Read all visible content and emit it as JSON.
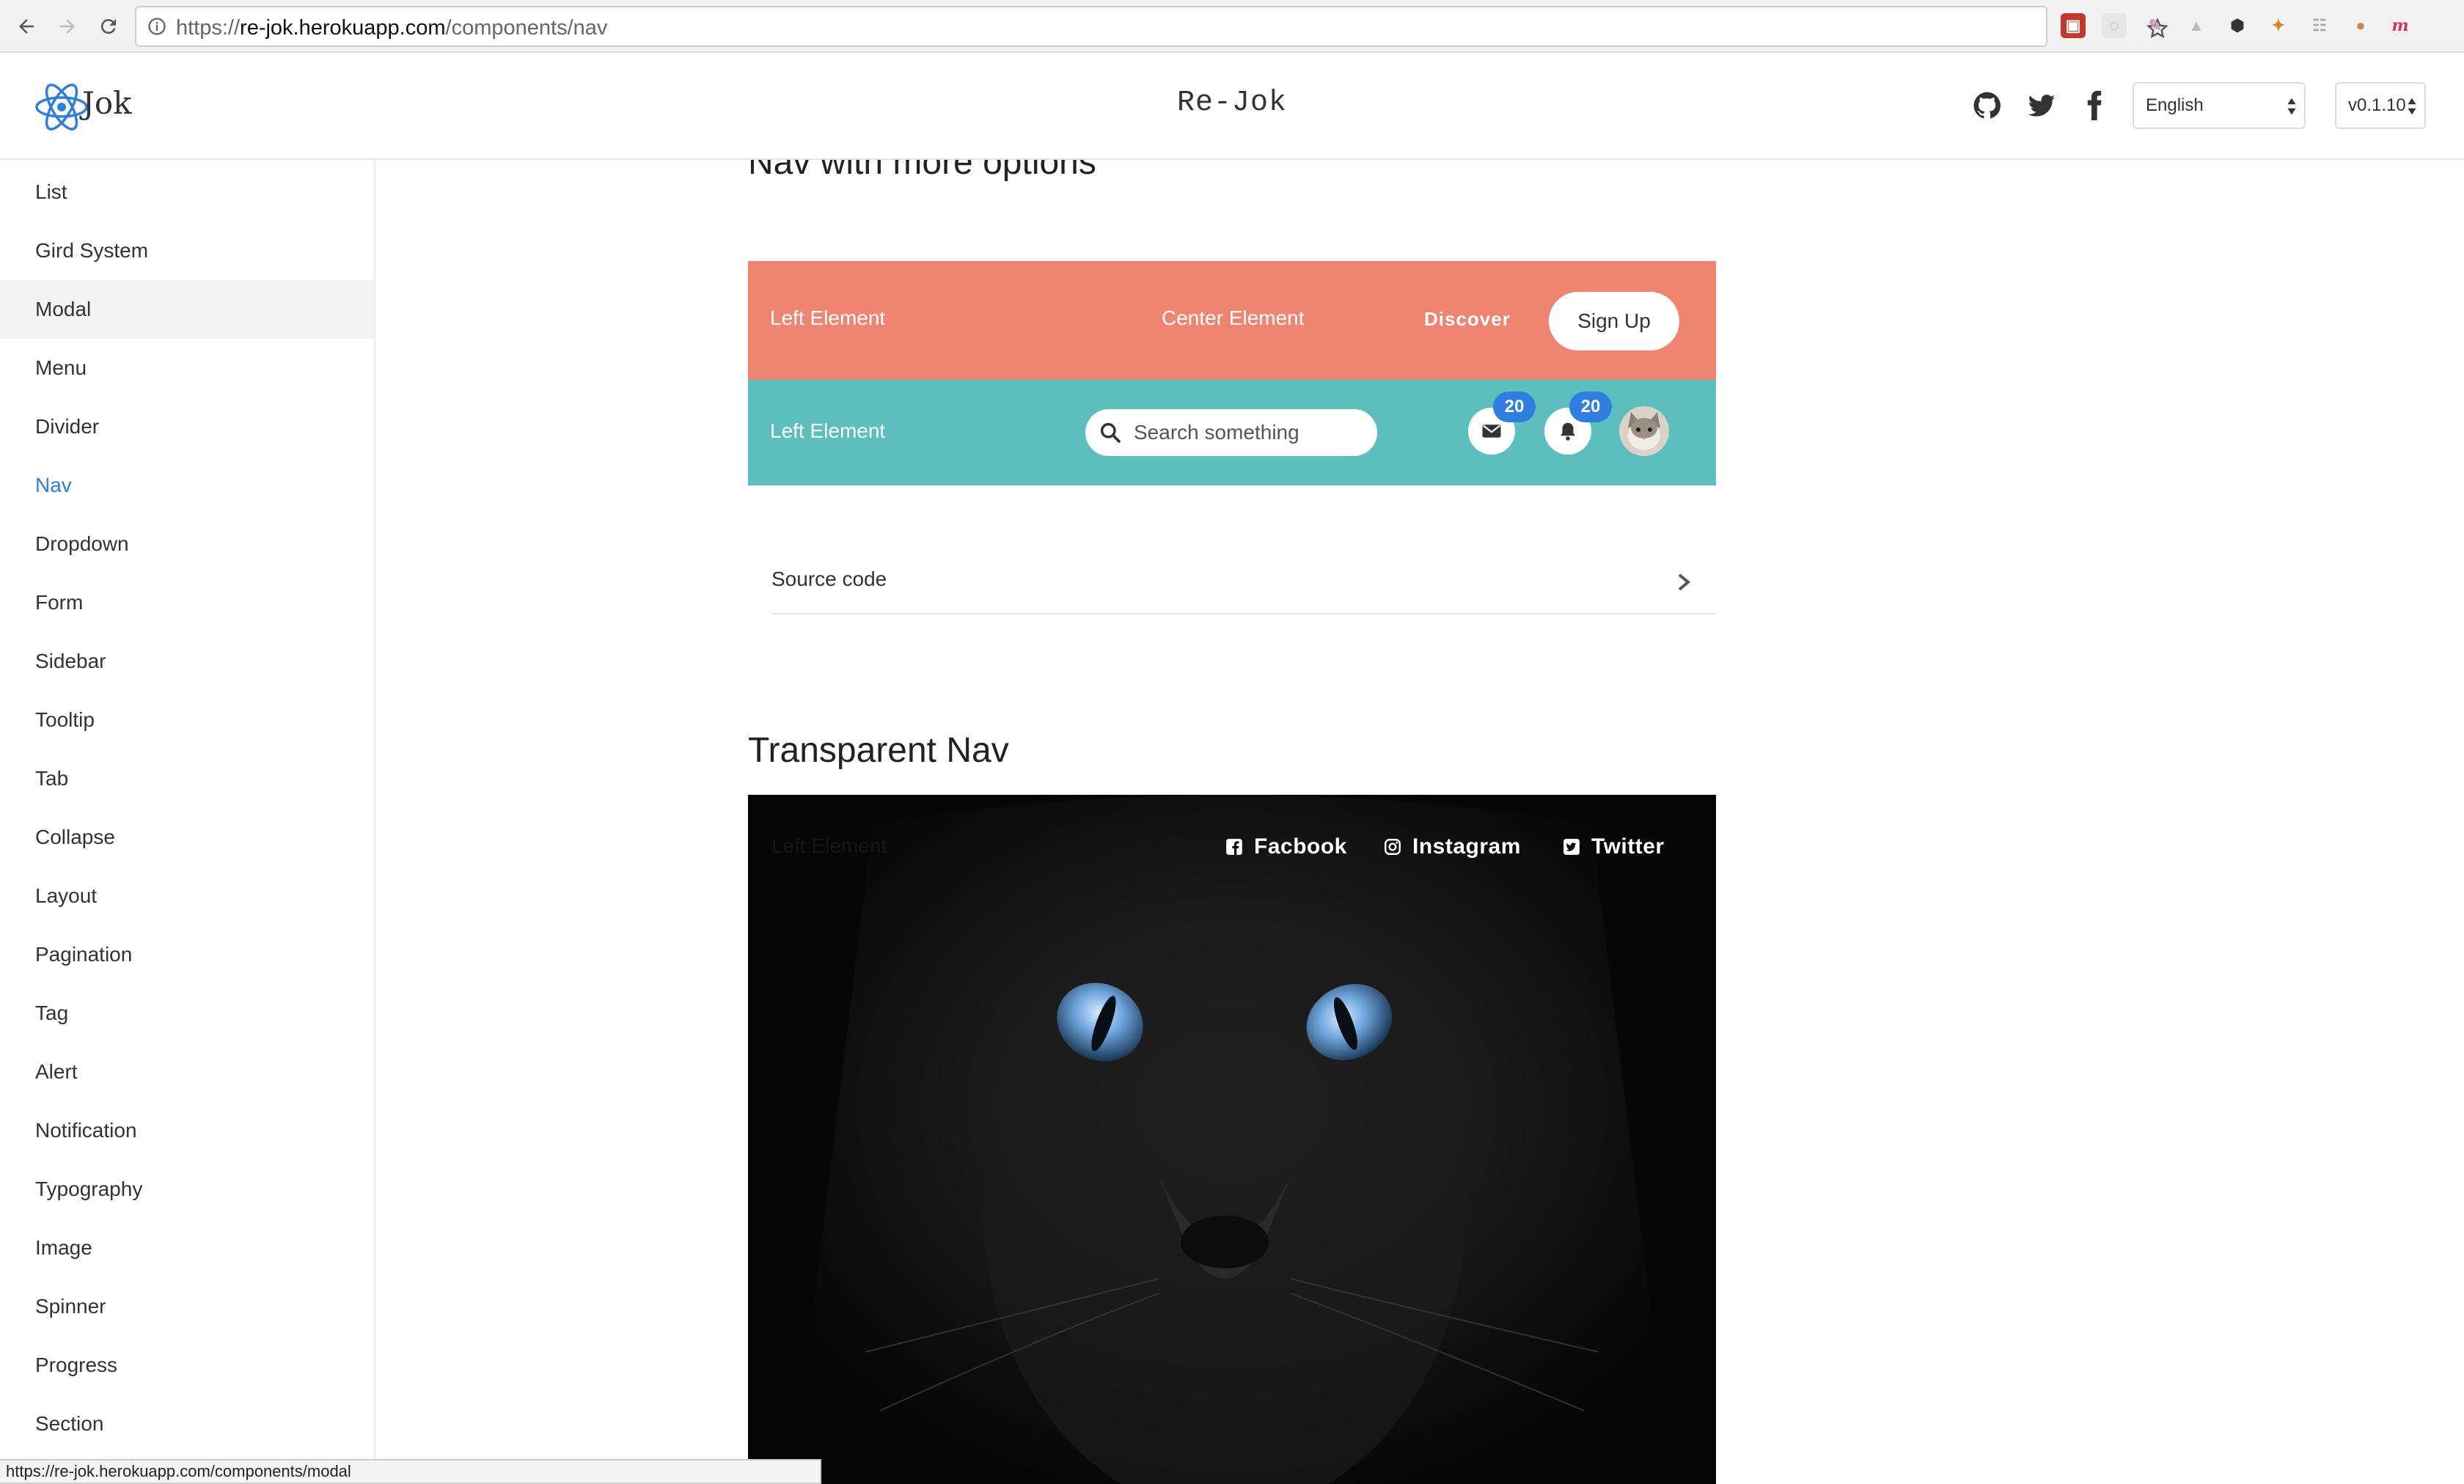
{
  "browser": {
    "url_scheme": "https://",
    "url_host": "re-jok.herokuapp.com",
    "url_path": "/components/nav"
  },
  "header": {
    "logo_text": "Jok",
    "title": "Re-Jok",
    "language": "English",
    "version": "v0.1.10"
  },
  "sidebar": {
    "items": [
      {
        "label": "List"
      },
      {
        "label": "Gird System"
      },
      {
        "label": "Modal"
      },
      {
        "label": "Menu"
      },
      {
        "label": "Divider"
      },
      {
        "label": "Nav"
      },
      {
        "label": "Dropdown"
      },
      {
        "label": "Form"
      },
      {
        "label": "Sidebar"
      },
      {
        "label": "Tooltip"
      },
      {
        "label": "Tab"
      },
      {
        "label": "Collapse"
      },
      {
        "label": "Layout"
      },
      {
        "label": "Pagination"
      },
      {
        "label": "Tag"
      },
      {
        "label": "Alert"
      },
      {
        "label": "Notification"
      },
      {
        "label": "Typography"
      },
      {
        "label": "Image"
      },
      {
        "label": "Spinner"
      },
      {
        "label": "Progress"
      },
      {
        "label": "Section"
      }
    ]
  },
  "main": {
    "section1_title": "Nav with more options",
    "nav_top": {
      "left": "Left Element",
      "center": "Center Element",
      "discover": "Discover",
      "signup": "Sign Up"
    },
    "nav_bottom": {
      "left": "Left Element",
      "search_placeholder": "Search something",
      "mail_count": "20",
      "bell_count": "20"
    },
    "source_code": "Source code",
    "section2_title": "Transparent Nav",
    "transparent_nav": {
      "left": "Left Element",
      "facebook": "Facbook",
      "instagram": "Instagram",
      "twitter": "Twitter"
    }
  },
  "status_bar": "https://re-jok.herokuapp.com/components/modal",
  "colors": {
    "nav_top_bg": "#ef8570",
    "nav_bottom_bg": "#5dbfbd",
    "accent": "#2f7fe0"
  }
}
